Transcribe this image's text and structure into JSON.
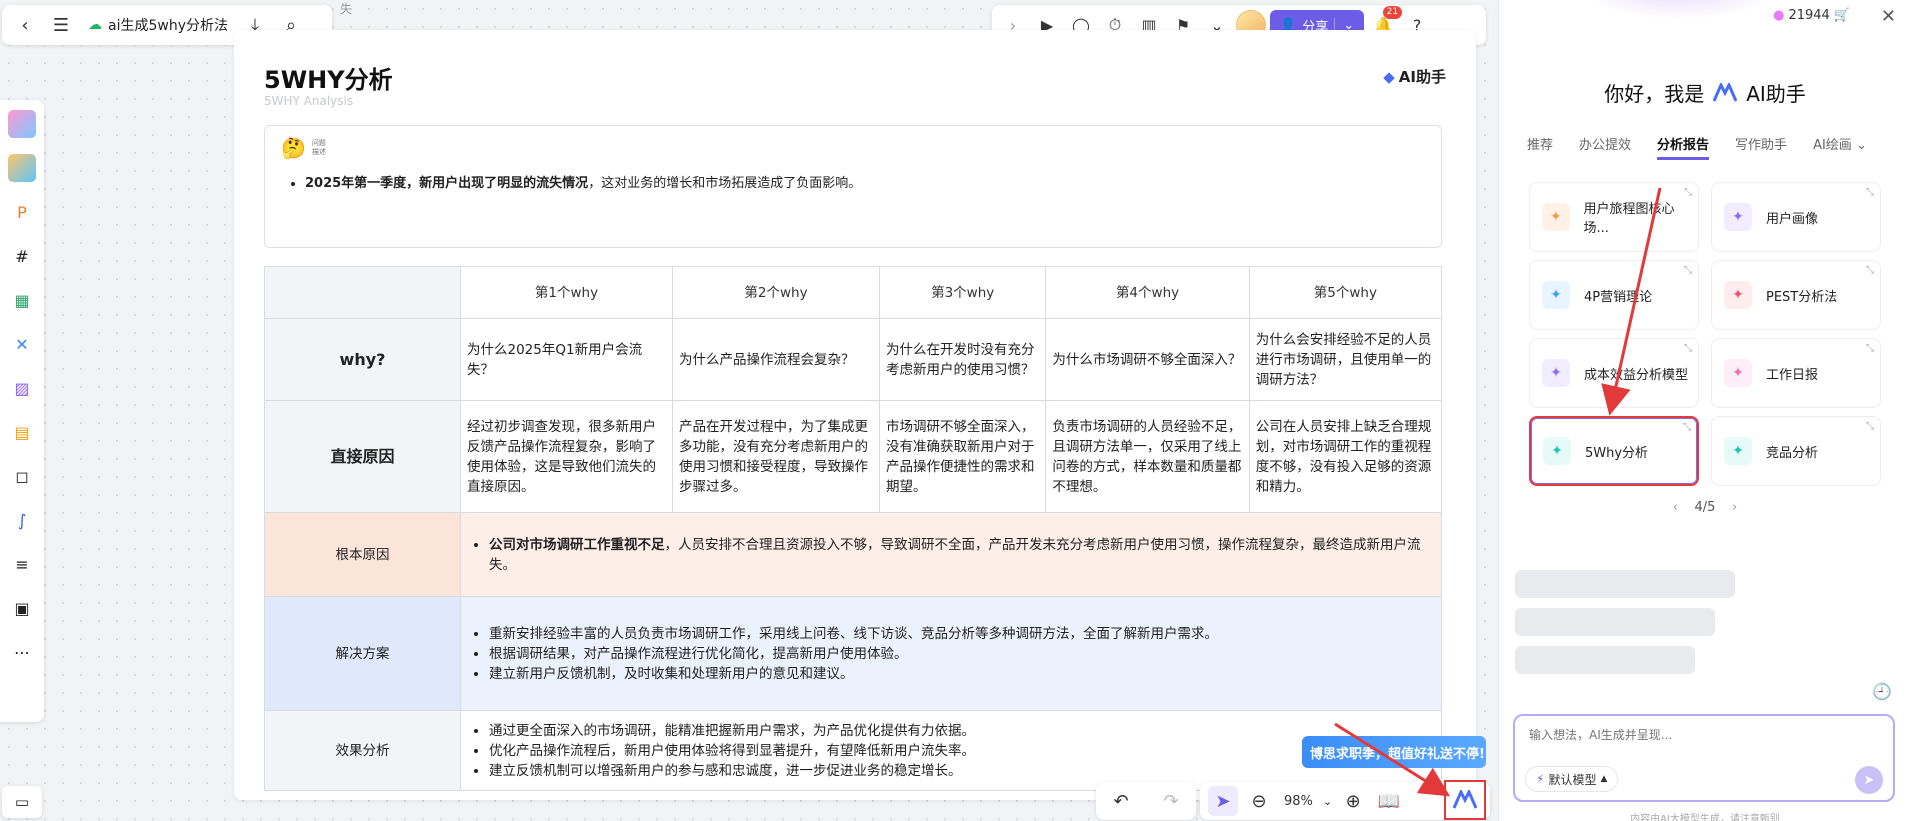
{
  "topbar": {
    "back_icon": "arrow-left-icon",
    "menu_icon": "hamburger-icon",
    "doc_title": "ai生成5why分析法",
    "faded_crumb": "失"
  },
  "toolbar_right": {
    "share_label": "分享",
    "notification_count": "21"
  },
  "document": {
    "title": "5WHY分析",
    "subtitle": "5WHY Analysis",
    "ai_badge": "AI助手",
    "problem_tiny_1": "问题",
    "problem_tiny_2": "描述",
    "problem_bold": "2025年第一季度，新用户出现了明显的流失情况",
    "problem_rest": "，这对业务的增长和市场拓展造成了负面影响。"
  },
  "table": {
    "headers": [
      "第1个why",
      "第2个why",
      "第3个why",
      "第4个why",
      "第5个why"
    ],
    "why_label": "why?",
    "why_cells": [
      "为什么2025年Q1新用户会流失？",
      "为什么产品操作流程会复杂？",
      "为什么在开发时没有充分考虑新用户的使用习惯？",
      "为什么市场调研不够全面深入？",
      "为什么会安排经验不足的人员进行市场调研，且使用单一的调研方法？"
    ],
    "direct_label": "直接原因",
    "direct_cells": [
      "经过初步调查发现，很多新用户反馈产品操作流程复杂，影响了使用体验，这是导致他们流失的直接原因。",
      "产品在开发过程中，为了集成更多功能，没有充分考虑新用户的使用习惯和接受程度，导致操作步骤过多。",
      "市场调研不够全面深入，没有准确获取新用户对于产品操作便捷性的需求和期望。",
      "负责市场调研的人员经验不足，且调研方法单一，仅采用了线上问卷的方式，样本数量和质量都不理想。",
      "公司在人员安排上缺乏合理规划，对市场调研工作的重视程度不够，没有投入足够的资源和精力。"
    ],
    "root_label": "根本原因",
    "root_bold": "公司对市场调研工作重视不足",
    "root_rest": "，人员安排不合理且资源投入不够，导致调研不全面，产品开发未充分考虑新用户使用习惯，操作流程复杂，最终造成新用户流失。",
    "solution_label": "解决方案",
    "solutions": [
      "重新安排经验丰富的人员负责市场调研工作，采用线上问卷、线下访谈、竞品分析等多种调研方法，全面了解新用户需求。",
      "根据调研结果，对产品操作流程进行优化简化，提高新用户使用体验。",
      "建立新用户反馈机制，及时收集和处理新用户的意见和建议。"
    ],
    "effect_label": "效果分析",
    "effects": [
      "通过更全面深入的市场调研，能精准把握新用户需求，为产品优化提供有力依据。",
      "优化产品操作流程后，新用户使用体验将得到显著提升，有望降低新用户流失率。",
      "建立反馈机制可以增强新用户的参与感和忠诚度，进一步促进业务的稳定增长。"
    ]
  },
  "bottom_bar": {
    "zoom": "98%",
    "promo": "博思求职季，超值好礼送不停!"
  },
  "panel": {
    "credits": "21944",
    "greeting_prefix": "你好，我是",
    "greeting_name": "AI助手",
    "tabs": [
      "推荐",
      "办公提效",
      "分析报告",
      "写作助手",
      "AI绘画"
    ],
    "active_tab": "分析报告",
    "cards": [
      {
        "label": "用户旅程图核心场...",
        "icon": "sparkle-icon",
        "color": "#f59a4a"
      },
      {
        "label": "用户画像",
        "icon": "sparkle-icon",
        "color": "#8b6cf0"
      },
      {
        "label": "4P营销理论",
        "icon": "sparkle-icon",
        "color": "#3da5f5"
      },
      {
        "label": "PEST分析法",
        "icon": "sparkle-icon",
        "color": "#f0506e"
      },
      {
        "label": "成本效益分析模型",
        "icon": "sparkle-icon",
        "color": "#8b6cf0"
      },
      {
        "label": "工作日报",
        "icon": "sparkle-icon",
        "color": "#f06fb5"
      },
      {
        "label": "5Why分析",
        "icon": "sparkle-icon",
        "color": "#1fc4b8"
      },
      {
        "label": "竞品分析",
        "icon": "sparkle-icon",
        "color": "#1fc4b8"
      }
    ],
    "pager": "4/5",
    "input_placeholder": "输入想法，AI生成并呈现...",
    "model_label": "默认模型",
    "disclaimer": "内容由AI大模型生成，请注意甄别"
  },
  "colors": {
    "accent": "#6c5ce7",
    "annotation_red": "#e23a3a"
  }
}
